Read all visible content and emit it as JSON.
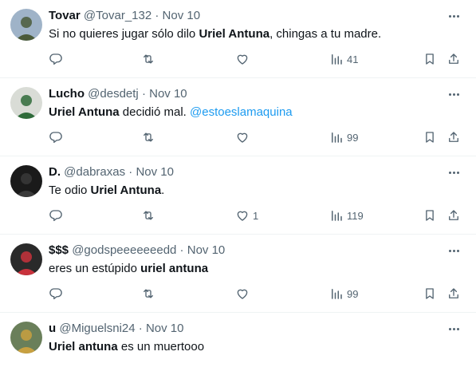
{
  "tweets": [
    {
      "name": "Tovar",
      "handle": "@Tovar_132",
      "date": "Nov 10",
      "segments": [
        {
          "t": "Si no quieres jugar sólo dilo ",
          "s": "plain"
        },
        {
          "t": "Uriel Antuna",
          "s": "bold"
        },
        {
          "t": ", chingas a tu madre.",
          "s": "plain"
        }
      ],
      "reply_count": "",
      "retweet_count": "",
      "like_count": "",
      "view_count": "41",
      "avatar_colors": [
        "#9fb3c8",
        "#4a5a3a"
      ]
    },
    {
      "name": "Lucho",
      "handle": "@desdetj",
      "date": "Nov 10",
      "segments": [
        {
          "t": "Uriel Antuna",
          "s": "bold"
        },
        {
          "t": " decidió mal. ",
          "s": "plain"
        },
        {
          "t": "@estoeslamaquina",
          "s": "mention"
        }
      ],
      "reply_count": "",
      "retweet_count": "",
      "like_count": "",
      "view_count": "99",
      "avatar_colors": [
        "#d9dcd6",
        "#2f6b3a"
      ]
    },
    {
      "name": "D.",
      "handle": "@dabraxas",
      "date": "Nov 10",
      "segments": [
        {
          "t": "Te odio ",
          "s": "plain"
        },
        {
          "t": "Uriel Antuna",
          "s": "bold"
        },
        {
          "t": ".",
          "s": "plain"
        }
      ],
      "reply_count": "",
      "retweet_count": "",
      "like_count": "1",
      "view_count": "119",
      "avatar_colors": [
        "#1a1a1a",
        "#3a3a3a"
      ]
    },
    {
      "name": "$$$",
      "handle": "@godspeeeeeeedd",
      "date": "Nov 10",
      "segments": [
        {
          "t": "eres un estúpido ",
          "s": "plain"
        },
        {
          "t": "uriel antuna",
          "s": "bold"
        }
      ],
      "reply_count": "",
      "retweet_count": "",
      "like_count": "",
      "view_count": "99",
      "avatar_colors": [
        "#2a2a2a",
        "#c8323c"
      ]
    },
    {
      "name": "u",
      "handle": "@Miguelsni24",
      "date": "Nov 10",
      "segments": [
        {
          "t": "Uriel antuna",
          "s": "bold"
        },
        {
          "t": " es un muertooo",
          "s": "plain"
        }
      ],
      "reply_count": "",
      "retweet_count": "",
      "like_count": "",
      "view_count": "",
      "avatar_colors": [
        "#6a7f5a",
        "#c8a040"
      ]
    }
  ],
  "separator": " · ",
  "icons": {
    "reply": "reply-icon",
    "retweet": "retweet-icon",
    "like": "like-icon",
    "views": "views-icon",
    "bookmark": "bookmark-icon",
    "share": "share-icon",
    "more": "more-icon"
  },
  "colors": {
    "text": "#0f1419",
    "secondary": "#536471",
    "link": "#1d9bf0",
    "divider": "#eff3f4"
  }
}
